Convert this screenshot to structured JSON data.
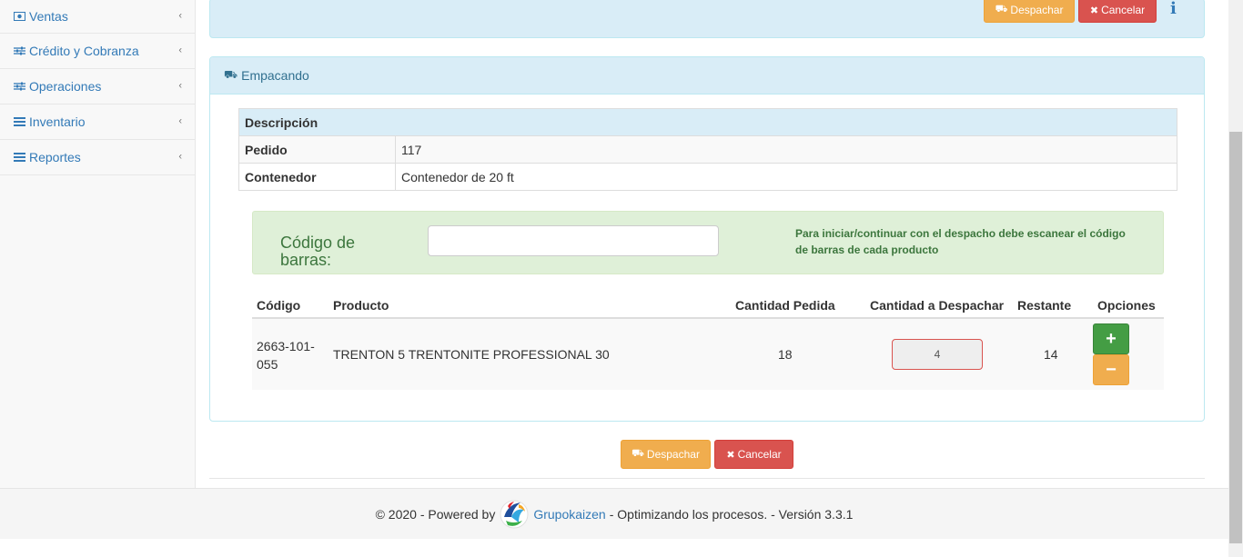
{
  "sidebar": {
    "items": [
      {
        "label": "Ventas",
        "icon": "money-icon"
      },
      {
        "label": "Crédito y Cobranza",
        "icon": "sliders-icon"
      },
      {
        "label": "Operaciones",
        "icon": "sliders-icon"
      },
      {
        "label": "Inventario",
        "icon": "list-icon"
      },
      {
        "label": "Reportes",
        "icon": "list-icon"
      }
    ],
    "chevron": "‹"
  },
  "top_actions": {
    "dispatch_label": "Despachar",
    "cancel_label": "Cancelar",
    "info_icon": "info-icon"
  },
  "panel": {
    "title": "Empacando",
    "desc_header": "Descripción",
    "rows": [
      {
        "key": "Pedido",
        "value": "117"
      },
      {
        "key": "Contenedor",
        "value": "Contenedor de 20 ft"
      }
    ]
  },
  "scan": {
    "label": "Código de barras:",
    "input_value": "",
    "help": "Para iniciar/continuar con el despacho debe escanear el código de barras de cada producto"
  },
  "products": {
    "headers": [
      "Código",
      "Producto",
      "Cantidad Pedida",
      "Cantidad a Despachar",
      "Restante",
      "Opciones"
    ],
    "rows": [
      {
        "code": "2663-101-055",
        "product": "TRENTON 5 TRENTONITE PROFESSIONAL 30",
        "ordered": "18",
        "dispatch": "4",
        "remaining": "14"
      }
    ],
    "plus_label": "+",
    "minus_label": "−"
  },
  "bottom_actions": {
    "dispatch_label": "Despachar",
    "cancel_label": "Cancelar"
  },
  "footer": {
    "prefix": "© 2020 - Powered by",
    "brand": "Grupokaizen",
    "suffix": "- Optimizando los procesos. - Versión 3.3.1"
  },
  "colors": {
    "primary": "#337ab7",
    "info_bg": "#d9edf7",
    "warning": "#f0ad4e",
    "danger": "#d9534f",
    "success": "#449d44",
    "success_bg": "#dff0d8"
  }
}
